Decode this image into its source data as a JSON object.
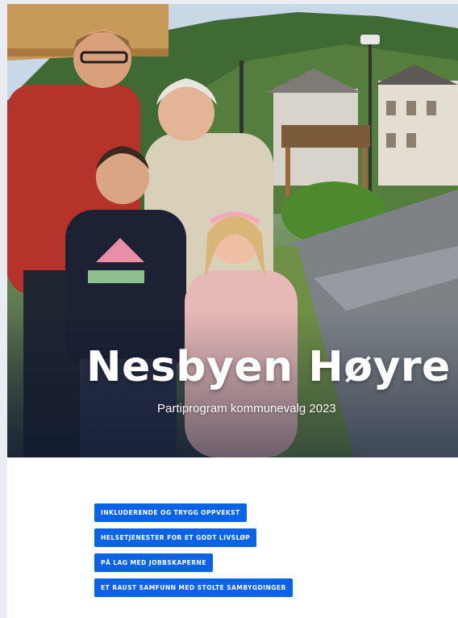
{
  "hero": {
    "title": "Nesbyen Høyre",
    "subtitle": "Partiprogram kommunevalg 2023"
  },
  "menu": {
    "items": [
      "INKLUDERENDE OG TRYGG OPPVEKST",
      "HELSETJENESTER FOR ET GODT LIVSLØP",
      "PÅ LAG MED JOBBSKAPERNE",
      "ET RAUST SAMFUNN MED STOLTE SAMBYGDINGER"
    ]
  },
  "colors": {
    "button": "#0a63e6",
    "page_background": "#e9edf2"
  }
}
